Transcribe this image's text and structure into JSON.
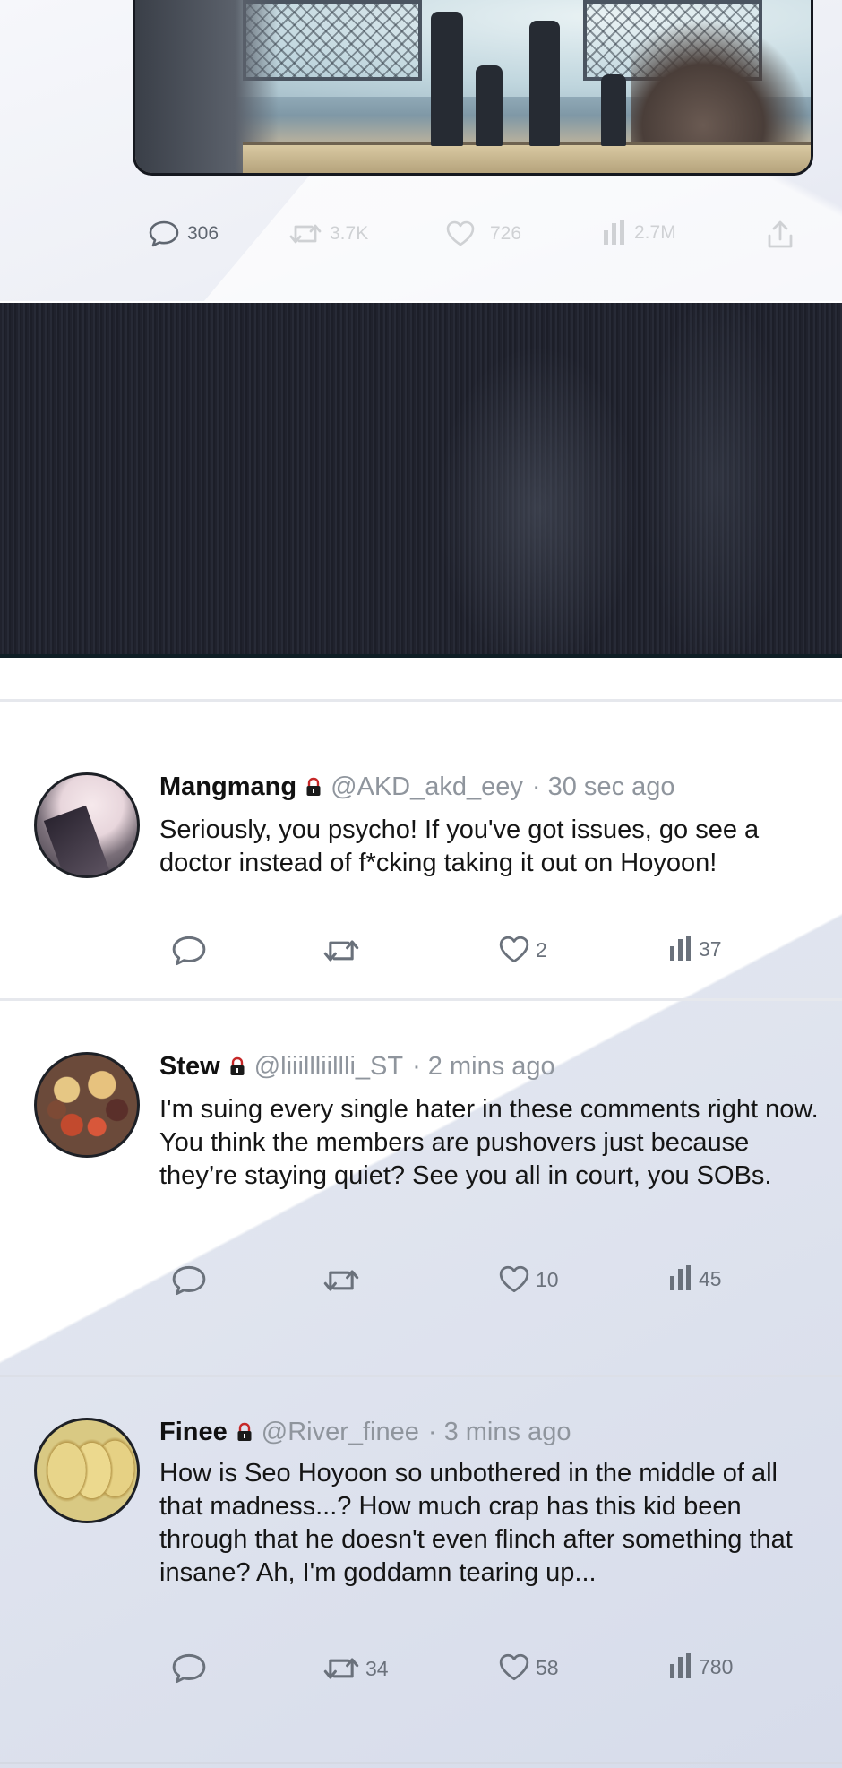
{
  "post": {
    "actions": {
      "replies": "306",
      "reposts": "3.7K",
      "likes": "726",
      "views": "2.7M"
    },
    "icons": [
      "reply-icon",
      "repost-icon",
      "heart-icon",
      "views-icon",
      "share-icon"
    ]
  },
  "comments": [
    {
      "name": "Mangmang",
      "handle": "@AKD_akd_eey",
      "time": "· 30 sec ago",
      "text": "Seriously, you psycho! If you've got issues, go see a doctor instead of f*cking taking it out on Hoyoon!",
      "replies": "",
      "reposts": "",
      "likes": "2",
      "views": "37"
    },
    {
      "name": "Stew",
      "handle": "@liiillliillli_ST",
      "time": "· 2 mins ago",
      "text": "I'm suing every single hater in these comments right now. You think the members are pushovers just because they’re staying quiet? See you all in court, you SOBs.",
      "replies": "",
      "reposts": "",
      "likes": "10",
      "views": "45"
    },
    {
      "name": "Finee",
      "handle": "@River_finee",
      "time": "· 3 mins ago",
      "text": "How is Seo Hoyoon so unbothered in the middle of all that madness...? How much crap has this kid been through that he doesn't even flinch after something that insane? Ah, I'm goddamn tearing up...",
      "replies": "",
      "reposts": "34",
      "likes": "58",
      "views": "780"
    }
  ],
  "colors": {
    "icon": "#6a717b",
    "handle": "#8f959d",
    "lock": "#c62828",
    "dark_band": "#22242f"
  }
}
